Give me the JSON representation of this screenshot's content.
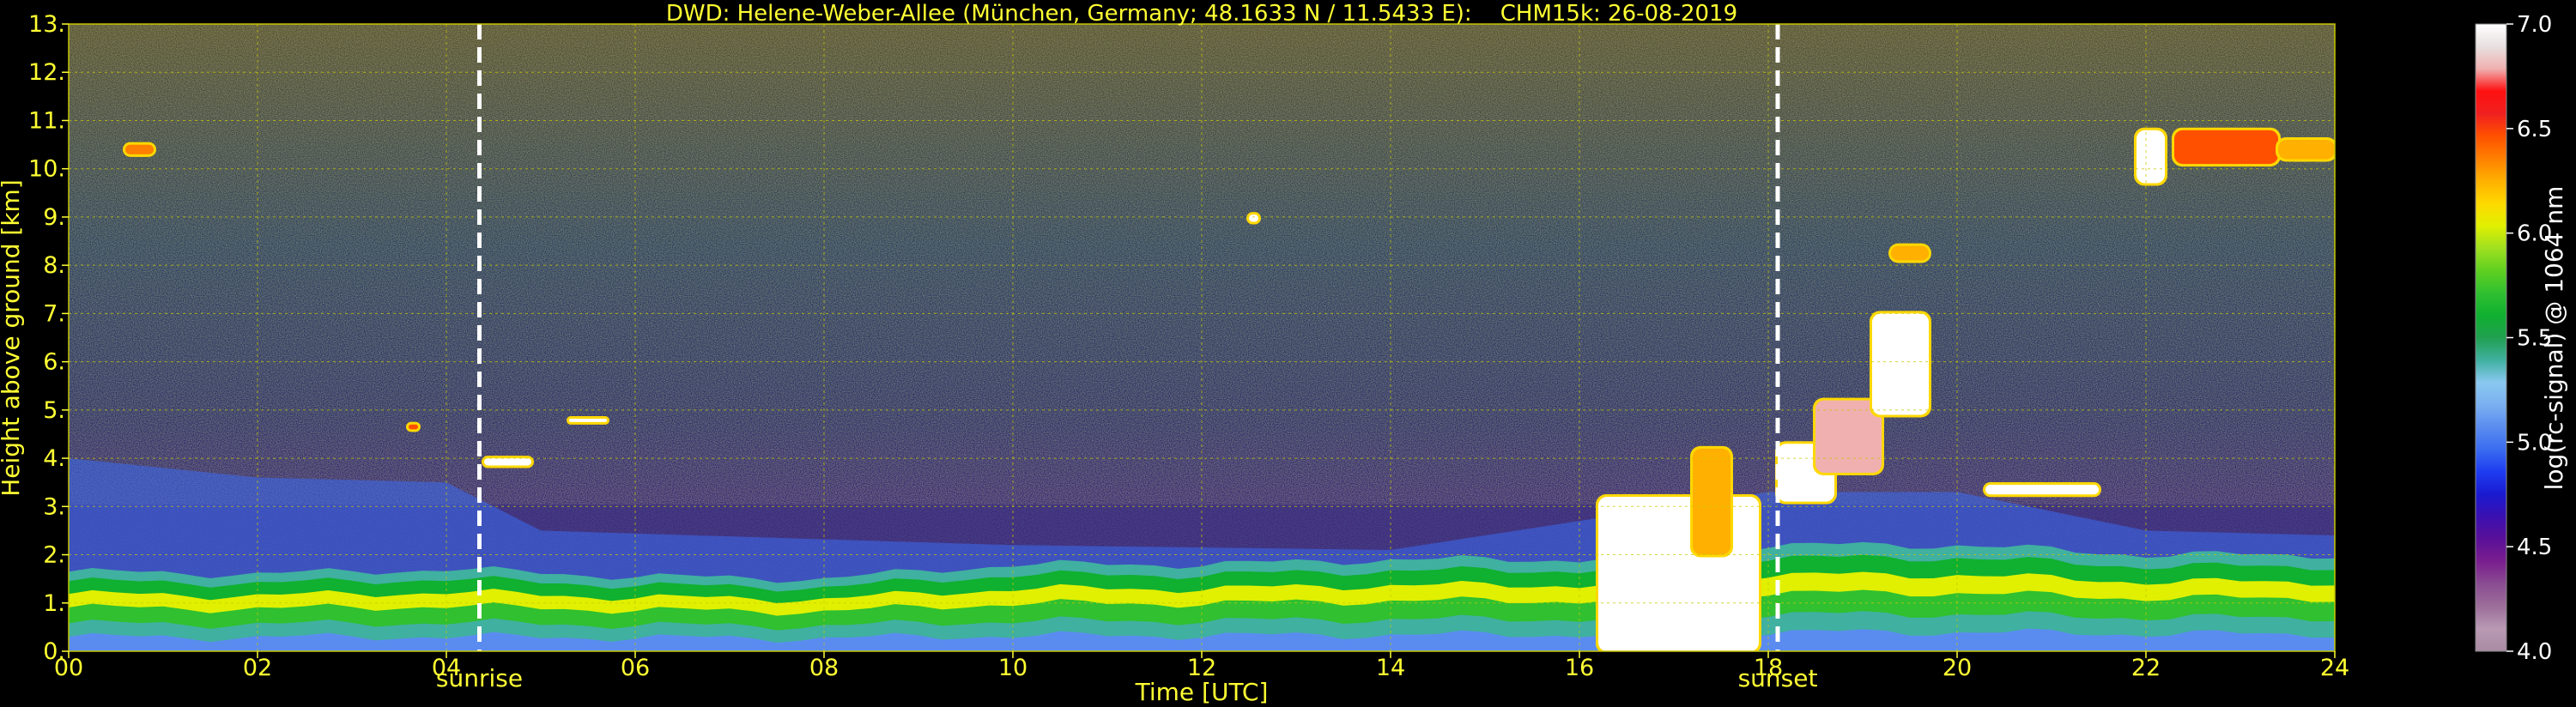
{
  "chart_data": {
    "type": "heatmap",
    "title": "DWD: Helene-Weber-Allee (München, Germany; 48.1633 N / 11.5433 E):    CHM15k: 26-08-2019",
    "xlabel": "Time [UTC]",
    "ylabel": "Height above ground [km]",
    "xlim": [
      0,
      24
    ],
    "ylim": [
      0,
      13
    ],
    "x_ticks": [
      "00",
      "02",
      "04",
      "06",
      "08",
      "10",
      "12",
      "14",
      "16",
      "18",
      "20",
      "22",
      "24"
    ],
    "y_ticks": [
      "0.",
      "1.",
      "2.",
      "3.",
      "4.",
      "5.",
      "6.",
      "7.",
      "8.",
      "9.",
      "10.",
      "11.",
      "12.",
      "13."
    ],
    "grid": true,
    "markers": [
      {
        "label": "sunrise",
        "time": 4.35
      },
      {
        "label": "sunset",
        "time": 18.1
      }
    ],
    "colorbar": {
      "label": "log(rc-signal) @ 1064 nm",
      "range": [
        4.0,
        7.0
      ],
      "ticks": [
        "4.0",
        "4.5",
        "5.0",
        "5.5",
        "6.0",
        "6.5",
        "7.0"
      ],
      "colors": [
        "#a98ba3",
        "#b89ab4",
        "#9c6e9a",
        "#8a4d92",
        "#7a1e8e",
        "#5a1098",
        "#3a10b0",
        "#1a1ad0",
        "#1e3cf0",
        "#3a6cf0",
        "#5a8cf0",
        "#7ab0f0",
        "#8ac8f0",
        "#40b0a0",
        "#20a050",
        "#10b030",
        "#30c030",
        "#60d020",
        "#a0e020",
        "#e0f000",
        "#ffd800",
        "#ffb000",
        "#ff8000",
        "#ff5000",
        "#f02020",
        "#ff1010",
        "#f0b0b0",
        "#e8e0e0",
        "#ffffff"
      ]
    },
    "background_mean_log_signal": 5.2,
    "boundary_layer_top_km": [
      [
        0,
        1.65
      ],
      [
        2,
        1.6
      ],
      [
        4,
        1.7
      ],
      [
        6,
        1.55
      ],
      [
        8,
        1.5
      ],
      [
        10,
        1.8
      ],
      [
        12,
        1.8
      ],
      [
        14,
        1.9
      ],
      [
        16,
        1.9
      ],
      [
        18,
        2.2
      ],
      [
        20,
        2.2
      ],
      [
        22,
        2.0
      ],
      [
        24,
        2.0
      ]
    ],
    "aerosol_layer_top_km": [
      [
        0,
        4.0
      ],
      [
        2,
        3.6
      ],
      [
        4,
        3.5
      ],
      [
        5,
        2.5
      ],
      [
        10,
        2.2
      ],
      [
        14,
        2.1
      ],
      [
        18,
        3.3
      ],
      [
        20,
        3.3
      ],
      [
        22,
        2.5
      ],
      [
        24,
        2.4
      ]
    ],
    "cloud_features": [
      {
        "t0": 0.6,
        "t1": 0.9,
        "z0": 10.3,
        "z1": 10.5,
        "value": 6.4
      },
      {
        "t0": 3.6,
        "t1": 3.7,
        "z0": 4.6,
        "z1": 4.7,
        "value": 6.5
      },
      {
        "t0": 4.4,
        "t1": 4.9,
        "z0": 3.85,
        "z1": 4.0,
        "value": 7.0
      },
      {
        "t0": 5.3,
        "t1": 5.7,
        "z0": 4.75,
        "z1": 4.82,
        "value": 7.0
      },
      {
        "t0": 12.5,
        "t1": 12.6,
        "z0": 8.9,
        "z1": 9.05,
        "value": 7.0
      },
      {
        "t0": 16.2,
        "t1": 17.9,
        "z0": 0.0,
        "z1": 3.2,
        "value": 7.0
      },
      {
        "t0": 17.2,
        "t1": 17.6,
        "z0": 2.0,
        "z1": 4.2,
        "value": 6.3
      },
      {
        "t0": 18.1,
        "t1": 18.7,
        "z0": 3.1,
        "z1": 4.3,
        "value": 7.0
      },
      {
        "t0": 18.5,
        "t1": 19.2,
        "z0": 3.7,
        "z1": 5.2,
        "value": 6.8
      },
      {
        "t0": 19.1,
        "t1": 19.7,
        "z0": 4.9,
        "z1": 7.0,
        "value": 7.0
      },
      {
        "t0": 19.3,
        "t1": 19.7,
        "z0": 8.1,
        "z1": 8.4,
        "value": 6.2
      },
      {
        "t0": 20.3,
        "t1": 21.5,
        "z0": 3.25,
        "z1": 3.45,
        "value": 7.0
      },
      {
        "t0": 21.9,
        "t1": 22.2,
        "z0": 9.7,
        "z1": 10.8,
        "value": 7.0
      },
      {
        "t0": 22.3,
        "t1": 23.4,
        "z0": 10.1,
        "z1": 10.8,
        "value": 6.5
      },
      {
        "t0": 23.4,
        "t1": 24.0,
        "z0": 10.2,
        "z1": 10.6,
        "value": 6.3
      }
    ]
  }
}
